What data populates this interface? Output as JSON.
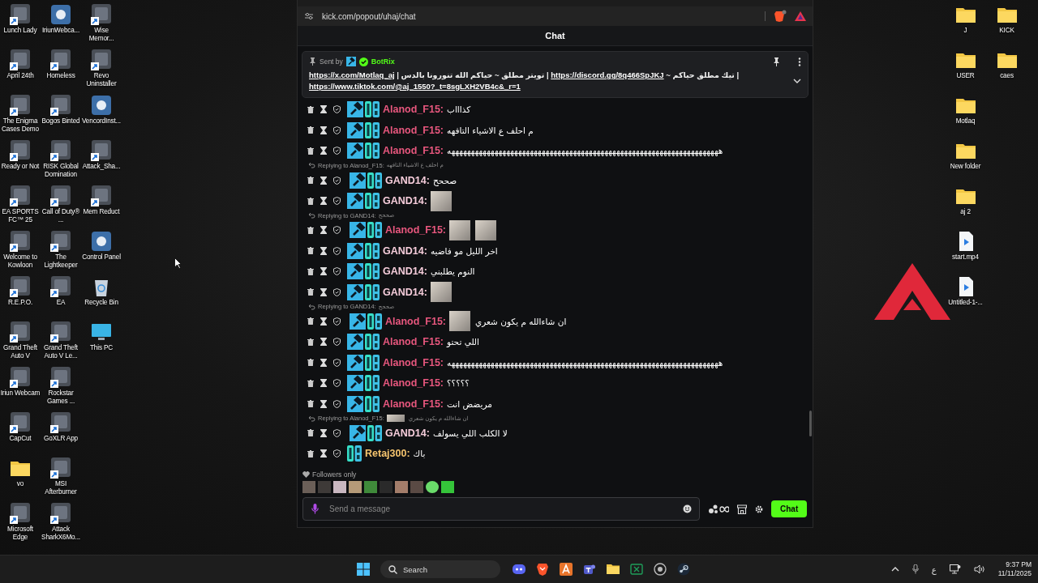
{
  "desktop_icons_left": [
    {
      "label": "Lunch Lady",
      "kind": "shortcut"
    },
    {
      "label": "April 24th",
      "kind": "shortcut"
    },
    {
      "label": "The Enigma Cases Demo",
      "kind": "shortcut"
    },
    {
      "label": "Ready or Not",
      "kind": "shortcut"
    },
    {
      "label": "EA SPORTS FC™ 25",
      "kind": "shortcut"
    },
    {
      "label": "Welcome to Kowloon",
      "kind": "shortcut"
    },
    {
      "label": "R.E.P.O.",
      "kind": "shortcut"
    },
    {
      "label": "Grand Theft Auto V",
      "kind": "shortcut"
    },
    {
      "label": "Iriun Webcam",
      "kind": "shortcut"
    },
    {
      "label": "CapCut",
      "kind": "shortcut"
    },
    {
      "label": "vo",
      "kind": "folder"
    },
    {
      "label": "Microsoft Edge",
      "kind": "shortcut"
    },
    {
      "label": "IriunWebca...",
      "kind": "app"
    },
    {
      "label": "Homeless",
      "kind": "shortcut"
    },
    {
      "label": "Bogos Binted",
      "kind": "shortcut"
    },
    {
      "label": "RISK Global Domination",
      "kind": "shortcut"
    },
    {
      "label": "Call of Duty® ...",
      "kind": "shortcut"
    },
    {
      "label": "The Lightkeeper",
      "kind": "shortcut"
    },
    {
      "label": "EA",
      "kind": "shortcut"
    },
    {
      "label": "Grand Theft Auto V Le...",
      "kind": "shortcut"
    },
    {
      "label": "Rockstar Games ...",
      "kind": "shortcut"
    },
    {
      "label": "GoXLR App",
      "kind": "shortcut"
    },
    {
      "label": "MSI Afterburner",
      "kind": "shortcut"
    },
    {
      "label": "Attack SharkX6Mo...",
      "kind": "shortcut"
    },
    {
      "label": "Wise Memor...",
      "kind": "shortcut"
    },
    {
      "label": "Revo Uninstaller",
      "kind": "shortcut"
    },
    {
      "label": "VencordInst...",
      "kind": "app"
    },
    {
      "label": "Attack_Sha...",
      "kind": "shortcut"
    },
    {
      "label": "Mem Reduct",
      "kind": "shortcut"
    },
    {
      "label": "Control Panel",
      "kind": "app"
    },
    {
      "label": "Recycle Bin",
      "kind": "bin"
    },
    {
      "label": "This PC",
      "kind": "monitor"
    }
  ],
  "desktop_icons_right": [
    {
      "label": "J",
      "kind": "folder"
    },
    {
      "label": "USER",
      "kind": "folder"
    },
    {
      "label": "Motlaq",
      "kind": "folder"
    },
    {
      "label": "New folder",
      "kind": "folder"
    },
    {
      "label": "aj 2",
      "kind": "folder"
    },
    {
      "label": "start.mp4",
      "kind": "file"
    },
    {
      "label": "Untitled-1-...",
      "kind": "file"
    },
    {
      "label": "KICK",
      "kind": "folder"
    },
    {
      "label": "caes",
      "kind": "folder"
    }
  ],
  "browser": {
    "url": "kick.com/popout/uhaj/chat"
  },
  "chat": {
    "title": "Chat",
    "pinned": {
      "sent_by": "Sent by",
      "author": "BotRix",
      "parts": [
        {
          "kind": "link",
          "text": "https://x.com/Motlaq_aj"
        },
        {
          "kind": "text",
          "text": " | تويتر مطلق ~ حياكم الله تنورونا بالدس | "
        },
        {
          "kind": "link",
          "text": "https://discord.gg/8q466SpJKJ"
        },
        {
          "kind": "text",
          "text": " ~ تيك مطلق حياكم | "
        },
        {
          "kind": "link",
          "text": "https://www.tiktok.com/@aj_1550?_t=8sgLXH2VB4c&_r=1"
        }
      ]
    },
    "messages": [
      {
        "user": "Alanod_F15:",
        "color": "#e8577e",
        "badges": [
          {
            "kind": "moderator"
          },
          {
            "kind": "og"
          }
        ],
        "parts": [
          {
            "kind": "text",
            "text": "كذاااب"
          }
        ]
      },
      {
        "user": "Alanod_F15:",
        "color": "#e8577e",
        "badges": [
          {
            "kind": "moderator"
          },
          {
            "kind": "og"
          }
        ],
        "parts": [
          {
            "kind": "text",
            "text": "م احلف ع الاشياء التافهه"
          }
        ]
      },
      {
        "user": "Alanod_F15:",
        "color": "#e8577e",
        "badges": [
          {
            "kind": "moderator"
          },
          {
            "kind": "og"
          }
        ],
        "parts": [
          {
            "kind": "text",
            "text": "هههههههههههههههههههههههههههههههههههههههههههههههههههههههههههههههههههههه"
          }
        ]
      },
      {
        "reply": {
          "label": "Replying to Alanod_F15:",
          "parts": [
            {
              "kind": "text",
              "text": "م احلف ع الاشياء التافهه"
            }
          ]
        },
        "user": "GAND14:",
        "color": "#f6cddb",
        "badges": [
          {
            "kind": "moderator"
          },
          {
            "kind": "og"
          }
        ],
        "parts": [
          {
            "kind": "text",
            "text": "صححح"
          }
        ]
      },
      {
        "user": "GAND14:",
        "color": "#f6cddb",
        "badges": [
          {
            "kind": "moderator"
          },
          {
            "kind": "og"
          }
        ],
        "parts": [
          {
            "kind": "emote"
          }
        ]
      },
      {
        "reply": {
          "label": "Replying to GAND14:",
          "parts": [
            {
              "kind": "text",
              "text": "صححح"
            }
          ]
        },
        "user": "Alanod_F15:",
        "color": "#e8577e",
        "badges": [
          {
            "kind": "moderator"
          },
          {
            "kind": "og"
          }
        ],
        "parts": [
          {
            "kind": "emote"
          },
          {
            "kind": "emote"
          }
        ]
      },
      {
        "user": "GAND14:",
        "color": "#f6cddb",
        "badges": [
          {
            "kind": "moderator"
          },
          {
            "kind": "og"
          }
        ],
        "parts": [
          {
            "kind": "text",
            "text": "اخر الليل مو فاضيه"
          }
        ]
      },
      {
        "user": "GAND14:",
        "color": "#f6cddb",
        "badges": [
          {
            "kind": "moderator"
          },
          {
            "kind": "og"
          }
        ],
        "parts": [
          {
            "kind": "text",
            "text": "النوم يطلبني"
          }
        ]
      },
      {
        "user": "GAND14:",
        "color": "#f6cddb",
        "badges": [
          {
            "kind": "moderator"
          },
          {
            "kind": "og"
          }
        ],
        "parts": [
          {
            "kind": "emote"
          }
        ]
      },
      {
        "reply": {
          "label": "Replying to GAND14:",
          "parts": [
            {
              "kind": "text",
              "text": "صححح"
            }
          ]
        },
        "user": "Alanod_F15:",
        "color": "#e8577e",
        "badges": [
          {
            "kind": "moderator"
          },
          {
            "kind": "og"
          }
        ],
        "parts": [
          {
            "kind": "emote"
          },
          {
            "kind": "text",
            "text": "ان شاءالله م يكون شعري"
          }
        ]
      },
      {
        "user": "Alanod_F15:",
        "color": "#e8577e",
        "badges": [
          {
            "kind": "moderator"
          },
          {
            "kind": "og"
          }
        ],
        "parts": [
          {
            "kind": "text",
            "text": "اللي تحتو"
          }
        ]
      },
      {
        "user": "Alanod_F15:",
        "color": "#e8577e",
        "badges": [
          {
            "kind": "moderator"
          },
          {
            "kind": "og"
          }
        ],
        "parts": [
          {
            "kind": "text",
            "text": "هههههههههههههههههههههههههههههههههههههههههههههههههههههههههههههههههههههه"
          }
        ]
      },
      {
        "user": "Alanod_F15:",
        "color": "#e8577e",
        "badges": [
          {
            "kind": "moderator"
          },
          {
            "kind": "og"
          }
        ],
        "parts": [
          {
            "kind": "text",
            "text": "؟؟؟؟؟"
          }
        ]
      },
      {
        "user": "Alanod_F15:",
        "color": "#e8577e",
        "badges": [
          {
            "kind": "moderator"
          },
          {
            "kind": "og"
          }
        ],
        "parts": [
          {
            "kind": "text",
            "text": "مريضض انت"
          }
        ]
      },
      {
        "reply": {
          "label": "Replying to Alanod_F15:",
          "parts": [
            {
              "kind": "emote"
            },
            {
              "kind": "text",
              "text": "ان شاءالله م يكون شعري"
            }
          ]
        },
        "user": "GAND14:",
        "color": "#f6cddb",
        "badges": [
          {
            "kind": "moderator"
          },
          {
            "kind": "og"
          }
        ],
        "parts": [
          {
            "kind": "text",
            "text": "لا الكلب اللي يسولف"
          }
        ]
      },
      {
        "user": "Retaj300:",
        "color": "#f5c46e",
        "badges": [
          {
            "kind": "og"
          }
        ],
        "parts": [
          {
            "kind": "text",
            "text": "باك"
          }
        ]
      }
    ],
    "followers_only": "Followers only",
    "input": {
      "placeholder": "Send a message"
    },
    "send_button": "Chat"
  },
  "taskbar": {
    "search_placeholder": "Search",
    "language": "ع",
    "time": "9:37 PM",
    "date": "11/11/2025"
  }
}
